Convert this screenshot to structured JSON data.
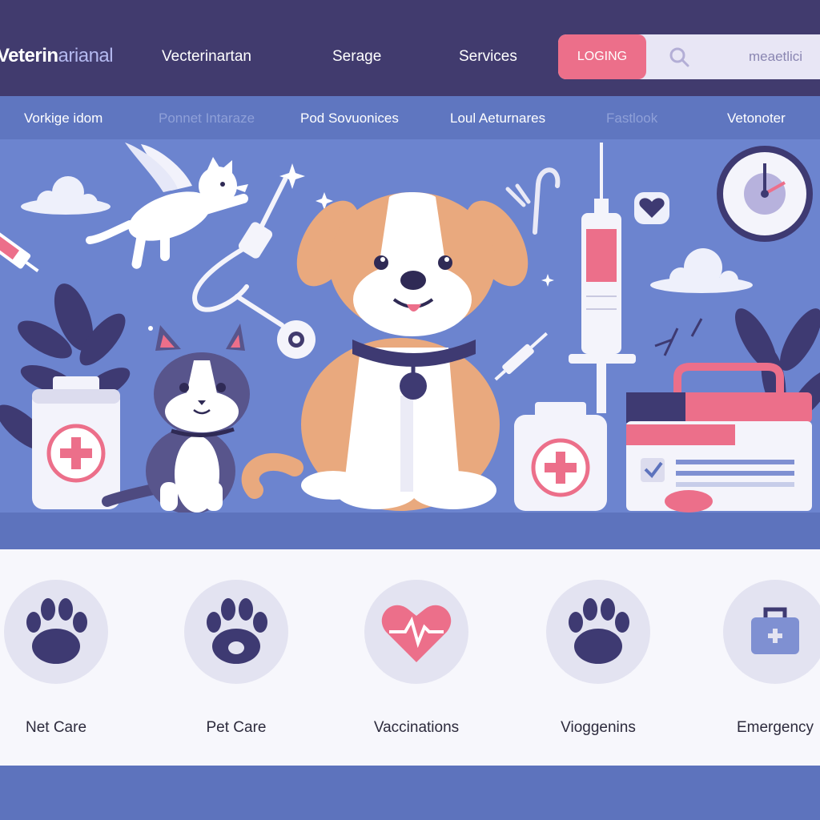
{
  "header": {
    "brand_main": "Veterin",
    "brand_tail": "arianal",
    "nav": [
      "Vecterinartan",
      "Serage",
      "Services"
    ],
    "login_label": "LOGING",
    "search_value": "meaetlici",
    "search_icon": "search-icon"
  },
  "subnav": {
    "items": [
      "Vorkige idom",
      "Ponnet Intaraze",
      "Pod Sovuonices",
      "Loul Aeturnares",
      "Fastlook",
      "Vetonoter"
    ]
  },
  "services": [
    {
      "label": "Net Care",
      "icon": "paw-icon"
    },
    {
      "label": "Pet Care",
      "icon": "paw-icon"
    },
    {
      "label": "Vaccinations",
      "icon": "heart-pulse-icon"
    },
    {
      "label": "Vioggenins",
      "icon": "paw-icon"
    },
    {
      "label": "Emergency",
      "icon": "medical-kit-icon"
    }
  ],
  "colors": {
    "header_bg": "#413b6e",
    "hero_bg": "#6c84cf",
    "accent_pink": "#ec6f8a",
    "services_bg": "#f7f7fc"
  }
}
